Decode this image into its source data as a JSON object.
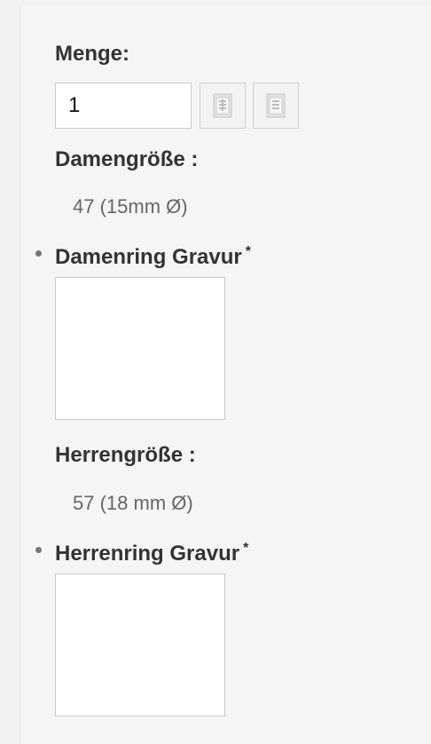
{
  "quantity": {
    "label": "Menge:",
    "value": "1",
    "increase_icon": "plus-icon",
    "decrease_icon": "minus-icon"
  },
  "ladies": {
    "size_label": "Damengröße :",
    "size_value": "47 (15mm Ø)",
    "engraving_label": "Damenring Gravur",
    "engraving_value": ""
  },
  "mens": {
    "size_label": "Herrengröße :",
    "size_value": "57 (18 mm Ø)",
    "engraving_label": "Herrenring Gravur",
    "engraving_value": ""
  },
  "required_marker": "*"
}
